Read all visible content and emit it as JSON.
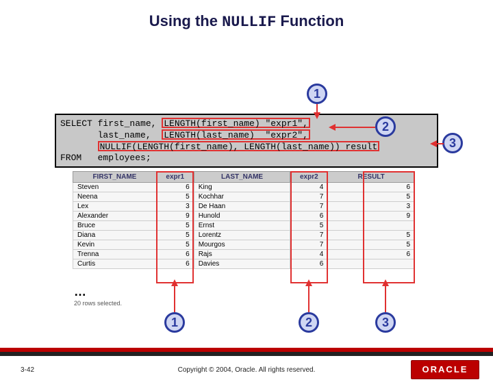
{
  "title_plain": "Using the ",
  "title_code": "NULLIF",
  "title_after": " Function",
  "sql": {
    "l1_pre": "SELECT first_name, ",
    "l1_hl": "LENGTH(first_name) \"expr1\",",
    "l2_pre": "       last_name,  ",
    "l2_hl": "LENGTH(last_name)  \"expr2\",",
    "l3_pre": "       ",
    "l3_hl": "NULLIF(LENGTH(first_name), LENGTH(last_name)) result",
    "l4": "FROM   employees;"
  },
  "callouts": {
    "top1": "1",
    "top2": "2",
    "top3": "3",
    "bot1": "1",
    "bot2": "2",
    "bot3": "3"
  },
  "table": {
    "headers": [
      "FIRST_NAME",
      "expr1",
      "LAST_NAME",
      "expr2",
      "RESULT"
    ],
    "rows": [
      [
        "Steven",
        "6",
        "King",
        "4",
        "6"
      ],
      [
        "Neena",
        "5",
        "Kochhar",
        "7",
        "5"
      ],
      [
        "Lex",
        "3",
        "De Haan",
        "7",
        "3"
      ],
      [
        "Alexander",
        "9",
        "Hunold",
        "6",
        "9"
      ],
      [
        "Bruce",
        "5",
        "Ernst",
        "5",
        ""
      ],
      [
        "Diana",
        "5",
        "Lorentz",
        "7",
        "5"
      ],
      [
        "Kevin",
        "5",
        "Mourgos",
        "7",
        "5"
      ],
      [
        "Trenna",
        "6",
        "Rajs",
        "4",
        "6"
      ],
      [
        "Curtis",
        "6",
        "Davies",
        "6",
        ""
      ]
    ]
  },
  "ellipsis": "…",
  "rows_selected": "20 rows selected.",
  "footer": {
    "page": "3-42",
    "copyright": "Copyright © 2004, Oracle.  All rights reserved.",
    "brand": "ORACLE"
  }
}
